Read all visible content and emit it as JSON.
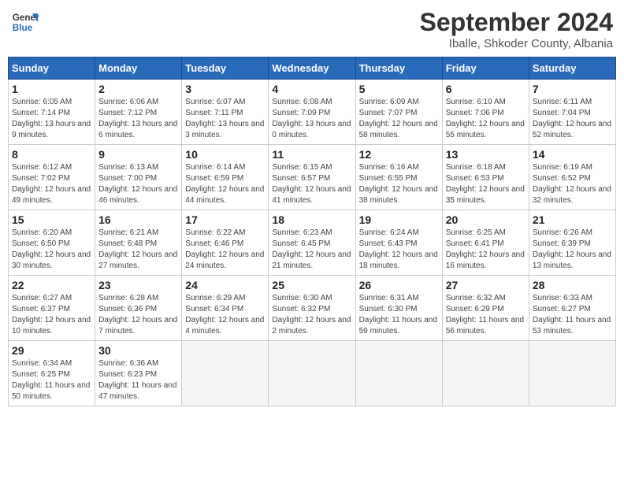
{
  "logo": {
    "line1": "General",
    "line2": "Blue"
  },
  "title": "September 2024",
  "subtitle": "Iballe, Shkoder County, Albania",
  "days_header": [
    "Sunday",
    "Monday",
    "Tuesday",
    "Wednesday",
    "Thursday",
    "Friday",
    "Saturday"
  ],
  "weeks": [
    [
      {
        "day": "1",
        "sunrise": "6:05 AM",
        "sunset": "7:14 PM",
        "daylight": "13 hours and 9 minutes."
      },
      {
        "day": "2",
        "sunrise": "6:06 AM",
        "sunset": "7:12 PM",
        "daylight": "13 hours and 6 minutes."
      },
      {
        "day": "3",
        "sunrise": "6:07 AM",
        "sunset": "7:11 PM",
        "daylight": "13 hours and 3 minutes."
      },
      {
        "day": "4",
        "sunrise": "6:08 AM",
        "sunset": "7:09 PM",
        "daylight": "13 hours and 0 minutes."
      },
      {
        "day": "5",
        "sunrise": "6:09 AM",
        "sunset": "7:07 PM",
        "daylight": "12 hours and 58 minutes."
      },
      {
        "day": "6",
        "sunrise": "6:10 AM",
        "sunset": "7:06 PM",
        "daylight": "12 hours and 55 minutes."
      },
      {
        "day": "7",
        "sunrise": "6:11 AM",
        "sunset": "7:04 PM",
        "daylight": "12 hours and 52 minutes."
      }
    ],
    [
      {
        "day": "8",
        "sunrise": "6:12 AM",
        "sunset": "7:02 PM",
        "daylight": "12 hours and 49 minutes."
      },
      {
        "day": "9",
        "sunrise": "6:13 AM",
        "sunset": "7:00 PM",
        "daylight": "12 hours and 46 minutes."
      },
      {
        "day": "10",
        "sunrise": "6:14 AM",
        "sunset": "6:59 PM",
        "daylight": "12 hours and 44 minutes."
      },
      {
        "day": "11",
        "sunrise": "6:15 AM",
        "sunset": "6:57 PM",
        "daylight": "12 hours and 41 minutes."
      },
      {
        "day": "12",
        "sunrise": "6:16 AM",
        "sunset": "6:55 PM",
        "daylight": "12 hours and 38 minutes."
      },
      {
        "day": "13",
        "sunrise": "6:18 AM",
        "sunset": "6:53 PM",
        "daylight": "12 hours and 35 minutes."
      },
      {
        "day": "14",
        "sunrise": "6:19 AM",
        "sunset": "6:52 PM",
        "daylight": "12 hours and 32 minutes."
      }
    ],
    [
      {
        "day": "15",
        "sunrise": "6:20 AM",
        "sunset": "6:50 PM",
        "daylight": "12 hours and 30 minutes."
      },
      {
        "day": "16",
        "sunrise": "6:21 AM",
        "sunset": "6:48 PM",
        "daylight": "12 hours and 27 minutes."
      },
      {
        "day": "17",
        "sunrise": "6:22 AM",
        "sunset": "6:46 PM",
        "daylight": "12 hours and 24 minutes."
      },
      {
        "day": "18",
        "sunrise": "6:23 AM",
        "sunset": "6:45 PM",
        "daylight": "12 hours and 21 minutes."
      },
      {
        "day": "19",
        "sunrise": "6:24 AM",
        "sunset": "6:43 PM",
        "daylight": "12 hours and 18 minutes."
      },
      {
        "day": "20",
        "sunrise": "6:25 AM",
        "sunset": "6:41 PM",
        "daylight": "12 hours and 16 minutes."
      },
      {
        "day": "21",
        "sunrise": "6:26 AM",
        "sunset": "6:39 PM",
        "daylight": "12 hours and 13 minutes."
      }
    ],
    [
      {
        "day": "22",
        "sunrise": "6:27 AM",
        "sunset": "6:37 PM",
        "daylight": "12 hours and 10 minutes."
      },
      {
        "day": "23",
        "sunrise": "6:28 AM",
        "sunset": "6:36 PM",
        "daylight": "12 hours and 7 minutes."
      },
      {
        "day": "24",
        "sunrise": "6:29 AM",
        "sunset": "6:34 PM",
        "daylight": "12 hours and 4 minutes."
      },
      {
        "day": "25",
        "sunrise": "6:30 AM",
        "sunset": "6:32 PM",
        "daylight": "12 hours and 2 minutes."
      },
      {
        "day": "26",
        "sunrise": "6:31 AM",
        "sunset": "6:30 PM",
        "daylight": "11 hours and 59 minutes."
      },
      {
        "day": "27",
        "sunrise": "6:32 AM",
        "sunset": "6:29 PM",
        "daylight": "11 hours and 56 minutes."
      },
      {
        "day": "28",
        "sunrise": "6:33 AM",
        "sunset": "6:27 PM",
        "daylight": "11 hours and 53 minutes."
      }
    ],
    [
      {
        "day": "29",
        "sunrise": "6:34 AM",
        "sunset": "6:25 PM",
        "daylight": "11 hours and 50 minutes."
      },
      {
        "day": "30",
        "sunrise": "6:36 AM",
        "sunset": "6:23 PM",
        "daylight": "11 hours and 47 minutes."
      },
      null,
      null,
      null,
      null,
      null
    ]
  ]
}
